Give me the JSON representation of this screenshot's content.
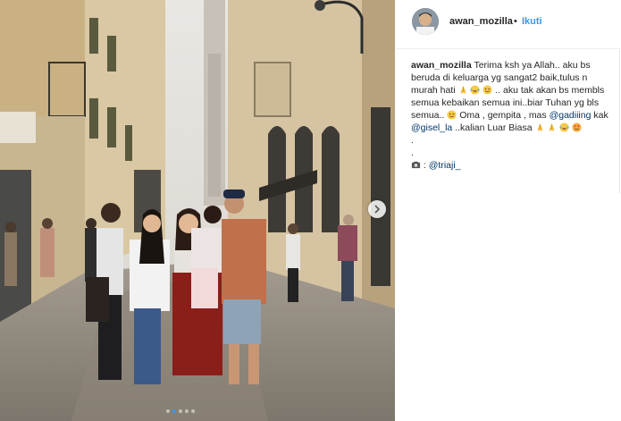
{
  "post": {
    "username": "awan_mozilla",
    "separator": "•",
    "follow_label": "Ikuti",
    "caption": {
      "username": "awan_mozilla",
      "part1": "Terima ksh ya Allah.. aku bs beruda di keluarga yg sangat2 baik,tulus n murah hati",
      "part2": ".. aku tak akan bs membls semua kebaikan semua ini..biar Tuhan yg bls semua..",
      "part3": "Oma , gempita , mas",
      "mention_gading": "@gadiiing",
      "kak": "kak",
      "mention_gisel": "@gisel_la",
      "part4": "..kalian Luar Biasa",
      "dot1": ".",
      "dot2": ".",
      "camera_sep": ":",
      "mention_credit": "@triaji_"
    },
    "carousel": {
      "slide_index": 2,
      "slide_count": 5
    }
  },
  "icons": {
    "next": "chevron-right-icon",
    "camera": "camera-icon",
    "pray": "folded-hands-emoji",
    "smile": "smiling-emoji",
    "tears": "tears-of-joy-emoji",
    "hearts": "heart-eyes-emoji"
  },
  "colors": {
    "follow": "#3897f0",
    "mention": "#003569",
    "text": "#262626"
  }
}
